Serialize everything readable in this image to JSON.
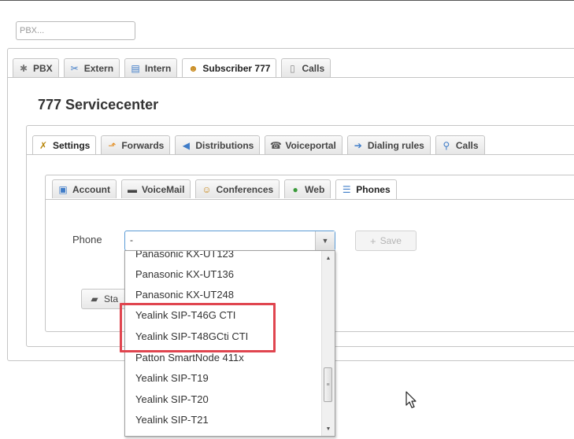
{
  "pbx_selector": {
    "value": "PBX..."
  },
  "main_tabs": [
    {
      "label": "PBX",
      "icon": "gear-icon",
      "active": false
    },
    {
      "label": "Extern",
      "icon": "tools-icon",
      "active": false
    },
    {
      "label": "Intern",
      "icon": "book-icon",
      "active": false
    },
    {
      "label": "Subscriber 777",
      "icon": "user-icon",
      "active": true
    },
    {
      "label": "Calls",
      "icon": "document-icon",
      "active": false
    }
  ],
  "subscriber_title": "777 Servicecenter",
  "sub_tabs": [
    {
      "label": "Settings",
      "icon": "wrench-icon",
      "active": true
    },
    {
      "label": "Forwards",
      "icon": "arrow-up-icon",
      "active": false
    },
    {
      "label": "Distributions",
      "icon": "distribution-icon",
      "active": false
    },
    {
      "label": "Voiceportal",
      "icon": "voiceportal-icon",
      "active": false
    },
    {
      "label": "Dialing rules",
      "icon": "dialing-rules-icon",
      "active": false
    },
    {
      "label": "Calls",
      "icon": "magnifier-icon",
      "active": false
    }
  ],
  "settings_tabs": [
    {
      "label": "Account",
      "icon": "account-icon",
      "active": false
    },
    {
      "label": "VoiceMail",
      "icon": "voicemail-icon",
      "active": false
    },
    {
      "label": "Conferences",
      "icon": "conference-icon",
      "active": false
    },
    {
      "label": "Web",
      "icon": "globe-icon",
      "active": false
    },
    {
      "label": "Phones",
      "icon": "list-icon",
      "active": true
    }
  ],
  "phone_form": {
    "label": "Phone",
    "selected_value": "-",
    "save_label": "Save",
    "start_label": "Sta"
  },
  "phone_options": [
    "Panasonic KX-UT123",
    "Panasonic KX-UT136",
    "Panasonic KX-UT248",
    "Yealink SIP-T46G CTI",
    "Yealink SIP-T48GCti CTI",
    "Patton SmartNode 411x",
    "Yealink SIP-T19",
    "Yealink SIP-T20",
    "Yealink SIP-T21"
  ],
  "colors": {
    "highlight_border": "#e0454f",
    "select_focus_border": "#5b9bd5",
    "panel_border": "#c5c5c5"
  }
}
